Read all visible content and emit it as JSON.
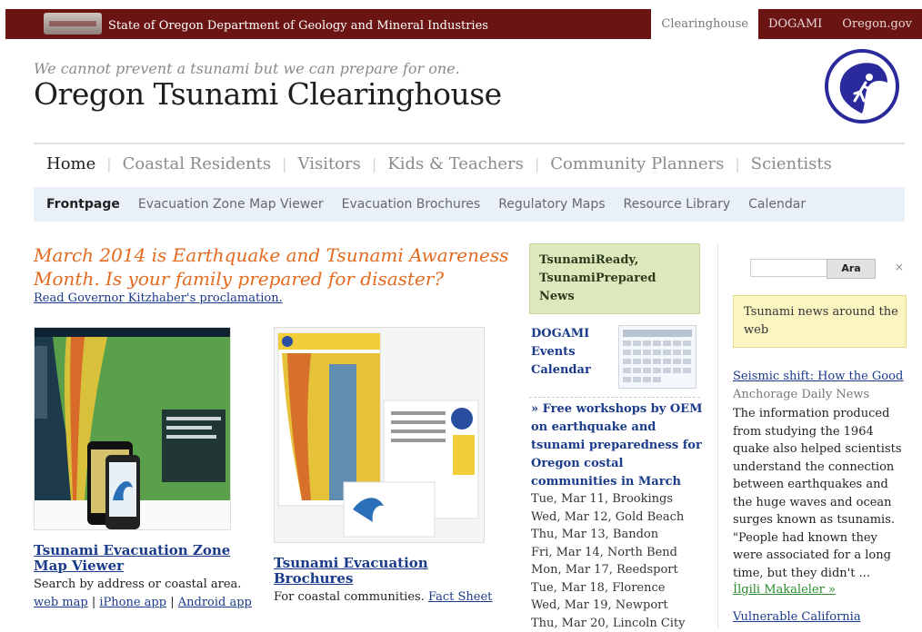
{
  "topbar": {
    "agency": "State of Oregon Department of Geology and Mineral Industries",
    "tabs": [
      "Clearinghouse",
      "DOGAMI",
      "Oregon.gov"
    ],
    "active_tab": "Clearinghouse",
    "bar_color": "#6b1414"
  },
  "header": {
    "tagline": "We cannot prevent a tsunami but we can prepare for one.",
    "title": "Oregon Tsunami Clearinghouse",
    "logo_icon": "tsunami-runner-logo"
  },
  "main_nav": [
    "Home",
    "Coastal Residents",
    "Visitors",
    "Kids & Teachers",
    "Community Planners",
    "Scientists"
  ],
  "sub_nav": [
    "Frontpage",
    "Evacuation Zone Map Viewer",
    "Evacuation Brochures",
    "Regulatory Maps",
    "Resource Library",
    "Calendar"
  ],
  "feature": {
    "headline": "March 2014 is Earthquake and Tsunami Awareness Month. Is your family prepared for disaster?",
    "proclamation_link": "Read Governor Kitzhaber's proclamation.",
    "map_viewer": {
      "title": "Tsunami Evacuation Zone Map Viewer",
      "desc": "Search by address or coastal area.",
      "links": [
        "web map",
        "iPhone app",
        "Android app"
      ]
    },
    "brochures": {
      "title": "Tsunami Evacuation Brochures",
      "desc": "For coastal communities.",
      "link": "Fact Sheet"
    }
  },
  "middle": {
    "ready_box": "TsunamiReady, TsunamiPrepared News",
    "events_calendar": "DOGAMI Events Calendar",
    "workshop_title": "» Free workshops by OEM on earthquake and tsunami preparedness for Oregon costal communities in March",
    "workshops": [
      "Tue, Mar 11, Brookings",
      "Wed, Mar 12, Gold Beach",
      "Thu, Mar 13, Bandon",
      "Fri, Mar 14, North Bend",
      "Mon, Mar 17, Reedsport",
      "Tue, Mar 18, Florence",
      "Wed, Mar 19, Newport",
      "Thu, Mar 20, Lincoln City"
    ]
  },
  "right": {
    "search_placeholder": "",
    "search_button": "Ara",
    "close_label": "×",
    "news_box": "Tsunami news around the web",
    "news_title": "Seismic shift: How the Good",
    "news_source": "Anchorage Daily News",
    "news_body": "The information produced from studying the 1964 quake also helped scientists understand the connection between earthquakes and the huge waves and ocean surges known as tsunamis. \"People had known they were associated for a long time, but they didn't ...",
    "news_more": "İlgili Makaleler »",
    "news_title2": "Vulnerable California"
  }
}
